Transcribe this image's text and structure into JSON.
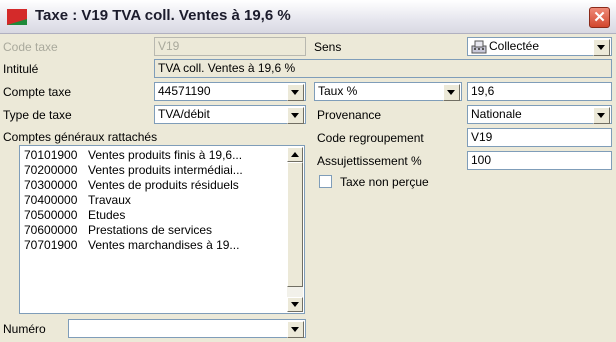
{
  "window": {
    "title": "Taxe : V19 TVA coll. Ventes à 19,6 %",
    "close_glyph": "✕"
  },
  "form": {
    "code_taxe": {
      "label": "Code taxe",
      "value": "V19"
    },
    "sens": {
      "label": "Sens",
      "value": "Collectée",
      "icon": "register-icon"
    },
    "intitule": {
      "label": "Intitulé",
      "value": "TVA coll. Ventes à 19,6 %"
    },
    "compte_taxe": {
      "label": "Compte taxe",
      "value": "44571190"
    },
    "taux": {
      "mode": "Taux %",
      "value": "19,6"
    },
    "type_taxe": {
      "label": "Type de taxe",
      "value": "TVA/débit"
    },
    "provenance": {
      "label": "Provenance",
      "value": "Nationale"
    },
    "code_regroupement": {
      "label": "Code regroupement",
      "value": "V19"
    },
    "assujettissement": {
      "label": "Assujettissement %",
      "value": "100"
    },
    "taxe_non_percue": {
      "label": "Taxe non perçue",
      "checked": false
    },
    "comptes_label": "Comptes généraux rattachés",
    "comptes": [
      {
        "code": "70101900",
        "name": "Ventes produits finis à 19,6..."
      },
      {
        "code": "70200000",
        "name": "Ventes produits intermédiai..."
      },
      {
        "code": "70300000",
        "name": "Ventes de produits résiduels"
      },
      {
        "code": "70400000",
        "name": "Travaux"
      },
      {
        "code": "70500000",
        "name": "Etudes"
      },
      {
        "code": "70600000",
        "name": "Prestations de services"
      },
      {
        "code": "70701900",
        "name": "Ventes marchandises à 19..."
      }
    ],
    "numero": {
      "label": "Numéro",
      "value": ""
    }
  }
}
